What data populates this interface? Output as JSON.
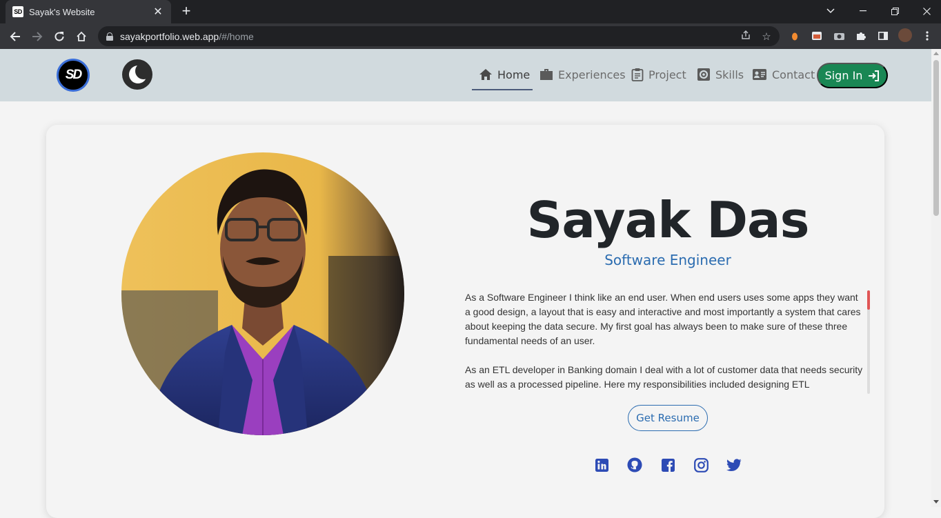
{
  "browser": {
    "tab_title": "Sayak's Website",
    "tab_favicon_text": "SD",
    "url_host": "sayakportfolio.web.app",
    "url_path": "/#/home"
  },
  "site": {
    "logo_text": "SD",
    "nav": [
      {
        "label": "Home",
        "icon": "home-icon",
        "active": true
      },
      {
        "label": "Experiences",
        "icon": "briefcase-icon",
        "active": false
      },
      {
        "label": "Project",
        "icon": "clipboard-icon",
        "active": false
      },
      {
        "label": "Skills",
        "icon": "gear-icon",
        "active": false
      },
      {
        "label": "Contact",
        "icon": "contact-card-icon",
        "active": false
      }
    ],
    "signin_label": "Sign In"
  },
  "profile": {
    "name": "Sayak Das",
    "role": "Software Engineer",
    "bio": [
      "As a Software Engineer I think like an end user. When end users uses some apps they want a good design, a layout that is easy and interactive and most importantly a system that cares about keeping the data secure. My first goal has always been to make sure of these three fundamental needs of an user.",
      "As an ETL developer in Banking domain I deal with a lot of customer data that needs security as well as a processed pipeline. Here my responsibilities included designing ETL"
    ],
    "resume_label": "Get Resume",
    "socials": [
      "linkedin-icon",
      "github-icon",
      "facebook-icon",
      "instagram-icon",
      "twitter-icon"
    ]
  },
  "colors": {
    "header_bg": "#d1dade",
    "signin_bg": "#198754",
    "accent_blue": "#2b6cb0",
    "social_blue": "#2d4bb5"
  }
}
